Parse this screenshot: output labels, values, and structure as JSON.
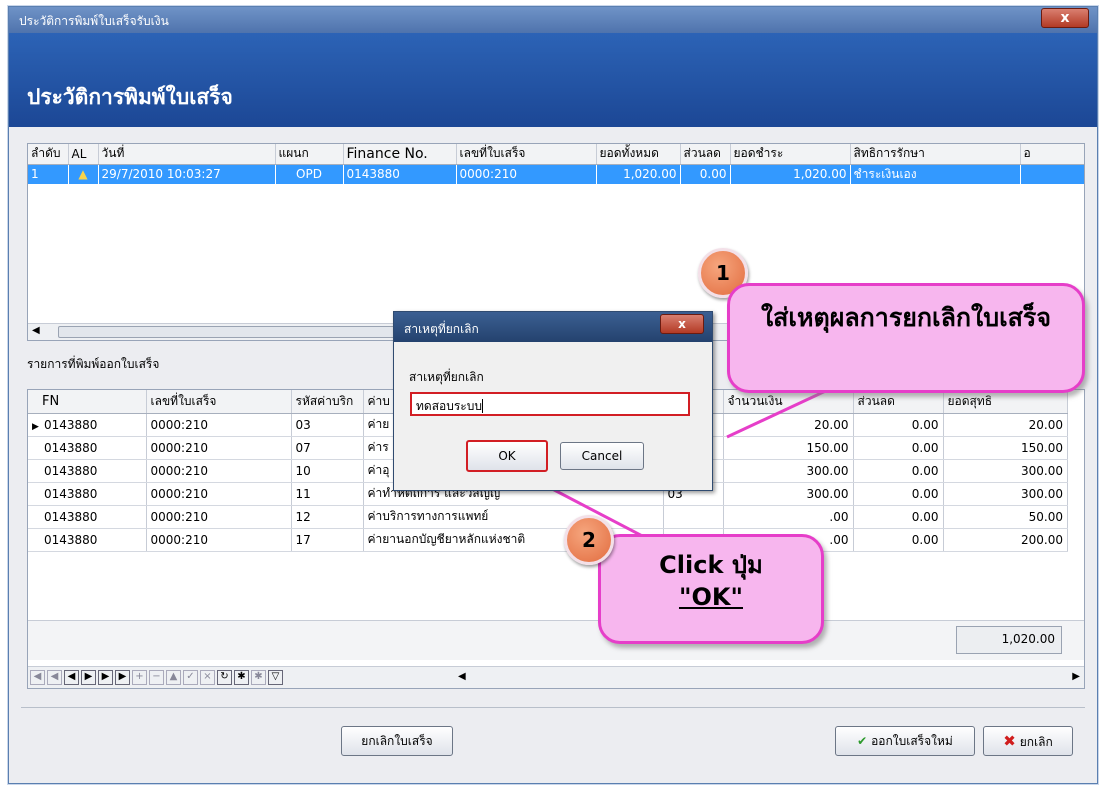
{
  "window": {
    "title": "ประวัติการพิมพ์ใบเสร็จรับเงิน",
    "close": "x",
    "header": "ประวัติการพิมพ์ใบเสร็จ"
  },
  "grid1": {
    "headers": [
      "ลำดับ",
      "AL",
      "วันที่",
      "แผนก",
      "Finance No.",
      "เลขที่ใบเสร็จ",
      "ยอดทั้งหมด",
      "ส่วนลด",
      "ยอดชำระ",
      "สิทธิการรักษา",
      "อ"
    ],
    "row": [
      "1",
      "29/7/2010 10:03:27",
      "OPD",
      "0143880",
      "0000:210",
      "1,020.00",
      "0.00",
      "1,020.00",
      "ชำระเงินเอง"
    ]
  },
  "grid2": {
    "label": "รายการที่พิมพ์ออกใบเสร็จ",
    "headers": [
      "FN",
      "เลขที่ใบเสร็จ",
      "รหัสค่าบริก",
      "ค่าบ",
      "",
      "จำนวนเงิน",
      "ส่วนลด",
      "ยอดสุทธิ"
    ],
    "rows": [
      {
        "fn": "0143880",
        "rc": "0000:210",
        "code": "03",
        "name": "ค่าย",
        "col": "",
        "amt": "20.00",
        "disc": "0.00",
        "net": "20.00"
      },
      {
        "fn": "0143880",
        "rc": "0000:210",
        "code": "07",
        "name": "ค่าร",
        "col": "",
        "amt": "150.00",
        "disc": "0.00",
        "net": "150.00"
      },
      {
        "fn": "0143880",
        "rc": "0000:210",
        "code": "10",
        "name": "ค่าอุ",
        "col": "",
        "amt": "300.00",
        "disc": "0.00",
        "net": "300.00"
      },
      {
        "fn": "0143880",
        "rc": "0000:210",
        "code": "11",
        "name": "ค่าทำหัตถการ และวิสัญญี",
        "col": "03",
        "amt": "300.00",
        "disc": "0.00",
        "net": "300.00"
      },
      {
        "fn": "0143880",
        "rc": "0000:210",
        "code": "12",
        "name": "ค่าบริการทางการแพทย์",
        "col": "",
        "amt": ".00",
        "disc": "0.00",
        "net": "50.00"
      },
      {
        "fn": "0143880",
        "rc": "0000:210",
        "code": "17",
        "name": "ค่ายานอกบัญชียาหลักแห่งชาติ",
        "col": "",
        "amt": ".00",
        "disc": "0.00",
        "net": "200.00"
      }
    ],
    "total": "1,020.00"
  },
  "dialog": {
    "title": "สาเหตุที่ยกเลิก",
    "label": "สาเหตุที่ยกเลิก",
    "value": "ทดสอบระบบ",
    "ok": "OK",
    "cancel": "Cancel",
    "close": "x"
  },
  "buttons": {
    "cancel_receipt": "ยกเลิกใบเสร็จ",
    "new_receipt": "ออกใบเสร็จใหม่",
    "cancel": "ยกเลิก"
  },
  "annotations": {
    "step1": "1",
    "bubble1": "ใส่เหตุผลการยกเลิกใบเสร็จ",
    "step2": "2",
    "bubble2_line1": "Click ปุ่ม",
    "bubble2_line2": "\"OK\""
  },
  "colors": {
    "header": "#2c63b6",
    "selection": "#3399ff",
    "bubble": "#f7b6ee",
    "bubble_border": "#e63ec9",
    "circle": "#e26c3f"
  }
}
